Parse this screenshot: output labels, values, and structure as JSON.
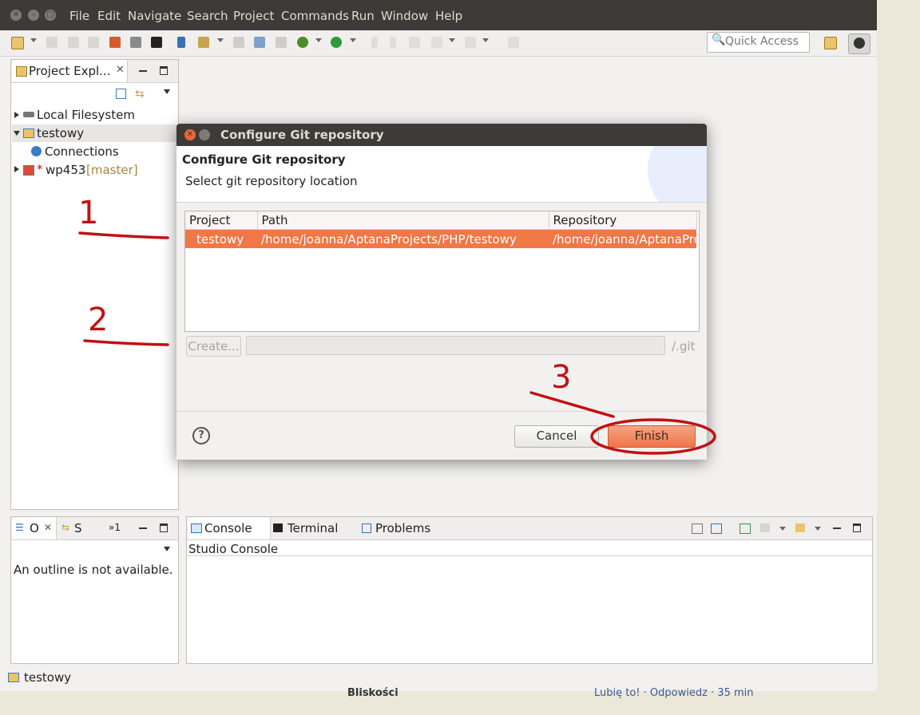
{
  "menubar": {
    "items": [
      "File",
      "Edit",
      "Navigate",
      "Search",
      "Project",
      "Commands",
      "Run",
      "Window",
      "Help"
    ]
  },
  "toolbar": {
    "quick_access_placeholder": "Quick Access"
  },
  "project_explorer": {
    "tab_label": "Project Expl...",
    "tree": [
      {
        "label": "Local Filesystem",
        "icon": "drive-icon",
        "expanded": false
      },
      {
        "label": "testowy",
        "icon": "project-folder-icon",
        "expanded": true
      },
      {
        "label": "Connections",
        "icon": "globe-icon"
      },
      {
        "label": "wp453",
        "branch": "[master]",
        "dirty_marker": "*",
        "icon": "git-project-icon",
        "expanded": false
      }
    ]
  },
  "outline_panel": {
    "tab1_label": "O",
    "tab2_label": "S",
    "overflow_label": "»1",
    "empty_message": "An outline is not available."
  },
  "console_panel": {
    "tabs": [
      "Console",
      "Terminal",
      "Problems"
    ],
    "console_title": "Studio Console"
  },
  "status_bar": {
    "selected_item": "testowy"
  },
  "background_page": {
    "heading": "Bliskości",
    "links": "Lubię to! · Odpowiedz · 35 min"
  },
  "dialog": {
    "title": "Configure Git repository",
    "header_title": "Configure Git repository",
    "header_message": "Select git repository location",
    "table_headers": [
      "Project",
      "Path",
      "Repository"
    ],
    "rows": [
      {
        "project": "testowy",
        "path": "/home/joanna/AptanaProjects/PHP/testowy",
        "repository": "/home/joanna/AptanaProjects/PHP/testowy"
      }
    ],
    "create_button": "Create...",
    "create_path_value": "",
    "git_suffix": "/.git",
    "cancel_button": "Cancel",
    "finish_button": "Finish"
  },
  "annotations": [
    "1",
    "2",
    "3"
  ],
  "colors": {
    "titlebar": "#3c3b37",
    "selection": "#f07746",
    "primary_button": "#ee7648",
    "annotation": "#c01212"
  }
}
